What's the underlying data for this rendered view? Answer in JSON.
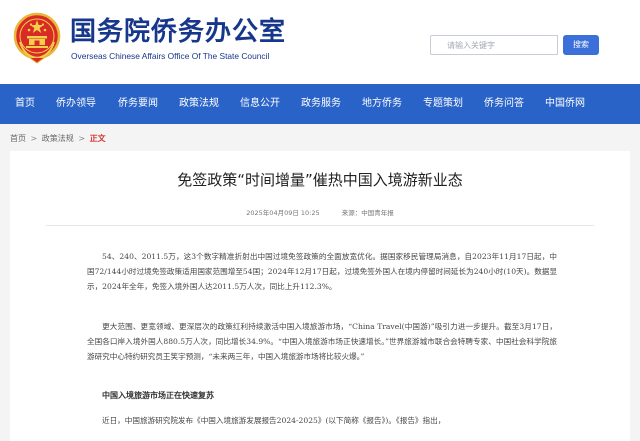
{
  "header": {
    "site_name_cn": "国务院侨务办公室",
    "site_name_en": "Overseas Chinese Affairs Office Of The State Council",
    "emblem_icon": "national-emblem-icon"
  },
  "search": {
    "placeholder": "请输入关键字",
    "button_label": "搜索"
  },
  "nav": {
    "items": [
      {
        "label": "首页"
      },
      {
        "label": "侨办领导"
      },
      {
        "label": "侨务要闻"
      },
      {
        "label": "政策法规"
      },
      {
        "label": "信息公开"
      },
      {
        "label": "政务服务"
      },
      {
        "label": "地方侨务"
      },
      {
        "label": "专题策划"
      },
      {
        "label": "侨务问答"
      },
      {
        "label": "中国侨网"
      }
    ]
  },
  "breadcrumb": {
    "home": "首页",
    "section": "政策法规",
    "current": "正文",
    "separator": ">"
  },
  "article": {
    "title": "免签政策“时间增量”催热中国入境游新业态",
    "date": "2025年04月09日 10:25",
    "source": "来源：中国青年报",
    "paragraph_1": "54、240、2011.5万，这3个数字精准折射出中国过境免签政策的全面放宽优化。据国家移民管理局消息，自2023年11月17日起，中国72/144小时过境免签政策适用国家范围增至54国；2024年12月17日起，过境免签外国人在境内停留时间延长为240小时(10天)。数据显示，2024年全年，免签入境外国人达2011.5万人次，同比上升112.3%。",
    "paragraph_2": "更大范围、更宽领域、更深层次的政策红利持续激活中国入境旅游市场，“China Travel(中国游)”吸引力进一步提升。截至3月17日，全国各口岸入境外国人880.5万人次，同比增长34.9%。“中国入境旅游市场正快速增长。”世界旅游城市联合会特聘专家、中国社会科学院旅游研究中心特约研究员王笑宇预测，“未来两三年，中国入境旅游市场将比较火爆。”",
    "subheading": "中国入境旅游市场正在快速复苏",
    "paragraph_3": "近日，中国旅游研究院发布《中国入境旅游发展报告2024-2025》(以下简称《报告》)。《报告》指出，"
  },
  "colors": {
    "brand_blue": "#17378c",
    "nav_blue": "#2a63c8",
    "button_blue": "#3a70d8",
    "breadcrumb_current": "#d0342c"
  }
}
